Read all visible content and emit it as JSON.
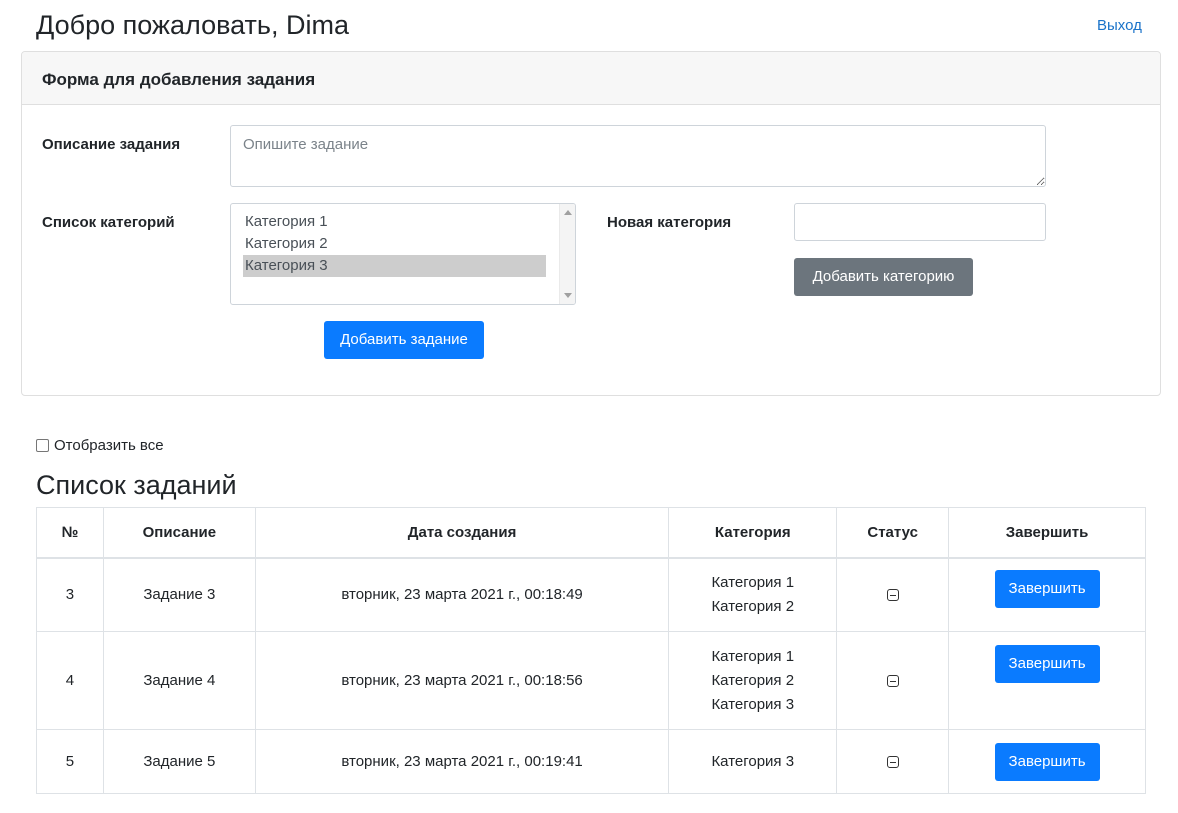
{
  "header": {
    "greeting": "Добро пожаловать, Dima",
    "logout_label": "Выход"
  },
  "form": {
    "title": "Форма для добавления задания",
    "description_label": "Описание задания",
    "description_placeholder": "Опишите задание",
    "description_value": "",
    "categories_label": "Список категорий",
    "categories": [
      {
        "label": "Категория 1",
        "selected": false
      },
      {
        "label": "Категория 2",
        "selected": false
      },
      {
        "label": "Категория 3",
        "selected": true
      }
    ],
    "new_category_label": "Новая категория",
    "new_category_value": "",
    "add_category_button": "Добавить категорию",
    "add_task_button": "Добавить задание"
  },
  "show_all": {
    "label": "Отобразить все",
    "checked": false
  },
  "tasks": {
    "title": "Список заданий",
    "columns": [
      "№",
      "Описание",
      "Дата создания",
      "Категория",
      "Статус",
      "Завершить"
    ],
    "rows": [
      {
        "num": "3",
        "description": "Задание 3",
        "created": "вторник, 23 марта 2021 г., 00:18:49",
        "categories": [
          "Категория 1",
          "Категория 2"
        ],
        "status_icon": "minus-square-icon",
        "action": "Завершить"
      },
      {
        "num": "4",
        "description": "Задание 4",
        "created": "вторник, 23 марта 2021 г., 00:18:56",
        "categories": [
          "Категория 1",
          "Категория 2",
          "Категория 3"
        ],
        "status_icon": "minus-square-icon",
        "action": "Завершить"
      },
      {
        "num": "5",
        "description": "Задание 5",
        "created": "вторник, 23 марта 2021 г., 00:19:41",
        "categories": [
          "Категория 3"
        ],
        "status_icon": "minus-square-icon",
        "action": "Завершить"
      }
    ]
  },
  "colors": {
    "primary": "#0a7bff",
    "secondary": "#6c757d",
    "link": "#1a73c9",
    "selected_option": "#cdcdcd"
  }
}
